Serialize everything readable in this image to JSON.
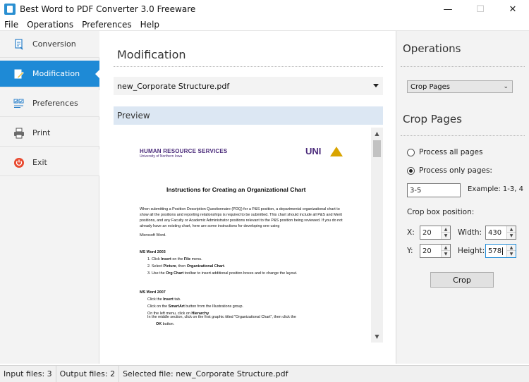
{
  "window": {
    "title": "Best Word to PDF Converter 3.0 Freeware",
    "minimize": "—",
    "maximize": "☐",
    "close": "✕"
  },
  "menu": [
    "File",
    "Operations",
    "Preferences",
    "Help"
  ],
  "sidebar": {
    "items": [
      {
        "label": "Conversion",
        "icon": "conversion-icon"
      },
      {
        "label": "Modification",
        "icon": "edit-icon",
        "active": true
      },
      {
        "label": "Preferences",
        "icon": "checklist-icon"
      },
      {
        "label": "Print",
        "icon": "printer-icon"
      },
      {
        "label": "Exit",
        "icon": "power-icon"
      }
    ],
    "active_color": "#1e8ad6"
  },
  "main": {
    "title": "Modification",
    "file_select": "new_Corporate Structure.pdf",
    "preview_label": "Preview",
    "document": {
      "header_org": "HUMAN RESOURCE SERVICES",
      "header_sub": "University of Northern Iowa",
      "logo": "UNI",
      "title": "Instructions for Creating an Organizational Chart",
      "intro": "When submitting a Position Description Questionnaire (PDQ) for a P&S position, a departmental organizational chart to show all the positions and reporting relationships is required to be submitted. This chart should include all P&S and Merit positions, and any Faculty or Academic Administrator positions relevant to the P&S position being reviewed. If you do not already have an existing chart, here are some instructions for developing one using",
      "software": "Microsoft Word.",
      "ms2003_heading": "MS Word 2003",
      "ms2003_step1_a": "1.   Click ",
      "ms2003_step1_b": "Insert",
      "ms2003_step1_c": " on the ",
      "ms2003_step1_d": "File",
      "ms2003_step1_e": " menu.",
      "ms2003_step2_a": "2.   Select ",
      "ms2003_step2_b": "Picture",
      "ms2003_step2_c": ", then ",
      "ms2003_step2_d": "Organizational Chart",
      "ms2003_step2_e": ".",
      "ms2003_step3_a": "3.   Use the ",
      "ms2003_step3_b": "Org Chart",
      "ms2003_step3_c": " toolbar to insert additional position boxes and to change the layout.",
      "ms2007_heading": "MS Word 2007",
      "ms2007_line1_a": "Click the ",
      "ms2007_line1_b": "Insert",
      "ms2007_line1_c": " tab.",
      "ms2007_line2_a": "Click on the ",
      "ms2007_line2_b": "SmartArt",
      "ms2007_line2_c": " button from the Illustrations group.",
      "ms2007_line3_a": "On the left menu, click on ",
      "ms2007_line3_b": "Hierarchy",
      "ms2007_line4": "In the middle section, click on the first graphic titled \"Organizational Chart\", then click  the",
      "ms2007_line5_a": "OK",
      "ms2007_line5_b": " button."
    }
  },
  "right": {
    "operations_title": "Operations",
    "operation_selected": "Crop Pages",
    "crop_title": "Crop Pages",
    "process_all": "Process all pages",
    "process_only": "Process only pages:",
    "pages_value": "3-5",
    "example": "Example: 1-3, 4",
    "crop_box_label": "Crop box position:",
    "x_label": "X:",
    "x_value": "20",
    "y_label": "Y:",
    "y_value": "20",
    "width_label": "Width:",
    "width_value": "430",
    "height_label": "Height:",
    "height_value": "578",
    "crop_button": "Crop"
  },
  "status": {
    "input_files": "Input files: 3",
    "output_files": "Output files: 2",
    "selected_file": "Selected file: new_Corporate Structure.pdf"
  }
}
